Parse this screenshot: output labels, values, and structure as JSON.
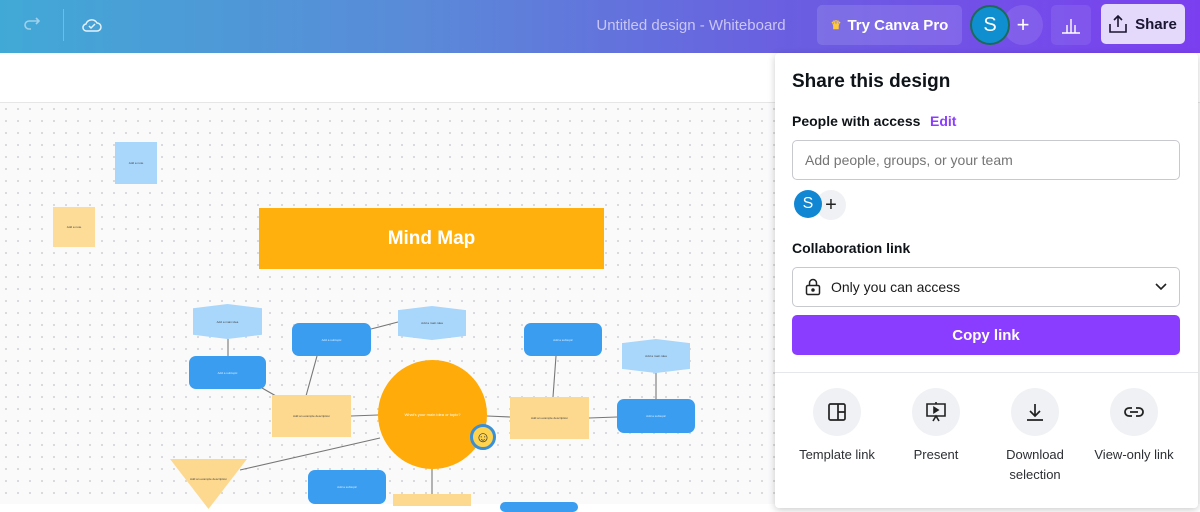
{
  "topbar": {
    "title": "Untitled design - Whiteboard",
    "pro_label": "Try Canva Pro",
    "avatar_initial": "S",
    "share_label": "Share"
  },
  "canvas": {
    "banner": "Mind Map",
    "center": "What's your main idea or topic?",
    "sticky1": "Add a note",
    "sticky2": "Add a note",
    "subtopic": "Add a subtopic",
    "subtopic_desc": "Add an example description",
    "idea": "Add a main idea"
  },
  "share": {
    "title": "Share this design",
    "people_label": "People with access",
    "edit_label": "Edit",
    "add_placeholder": "Add people, groups, or your team",
    "avatar_initial": "S",
    "collab_label": "Collaboration link",
    "access_value": "Only you can access",
    "copy_label": "Copy link",
    "options": [
      {
        "label": "Template link"
      },
      {
        "label": "Present"
      },
      {
        "label": "Download selection"
      },
      {
        "label": "View-only link"
      }
    ]
  },
  "colors": {
    "accent": "#8b3dff",
    "orange": "#ffb00c",
    "blue": "#3a9df0"
  }
}
